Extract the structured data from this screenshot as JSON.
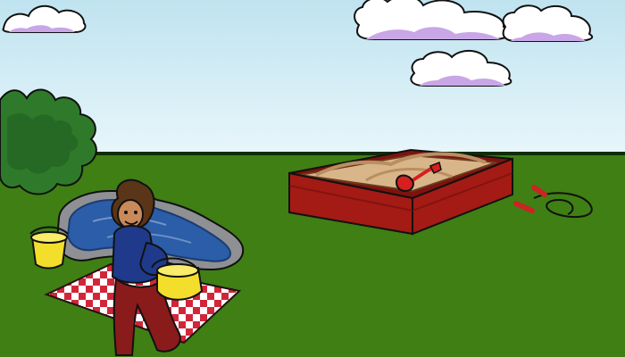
{
  "scene": {
    "colors": {
      "sky_top": "#bfe3ef",
      "sky_bottom": "#e7f6fb",
      "grass": "#3f7f14",
      "horizon": "#0f2d06",
      "cloud_white": "#ffffff",
      "cloud_shade": "#c9a6e6",
      "bush": "#2f7a2a",
      "bush_dark": "#1f5b1f",
      "pond_water": "#2b5da8",
      "pond_rock": "#8f9093",
      "sandbox_wood": "#a31b14",
      "sandbox_wood_dark": "#7f120e",
      "sand": "#d9b58a",
      "sand_dark": "#b98f62",
      "shovel": "#d61f1f",
      "jump_rope_handle": "#c82622",
      "bucket_yellow": "#f4de2c",
      "blanket_red": "#d1263a",
      "blanket_white": "#ffffff",
      "character_shirt": "#1f3a8a",
      "character_pants": "#8a1b1b",
      "character_skin": "#c98a5a",
      "character_hair": "#5a3517"
    },
    "icons": {
      "clouds": "cloud-icon",
      "bush": "bush-icon",
      "pond": "pond-icon",
      "sandbox": "sandbox-icon",
      "shovel": "shovel-icon",
      "jump_rope": "jump-rope-icon",
      "bucket": "bucket-icon",
      "picnic_blanket": "picnic-blanket-icon",
      "character": "character-icon"
    }
  }
}
